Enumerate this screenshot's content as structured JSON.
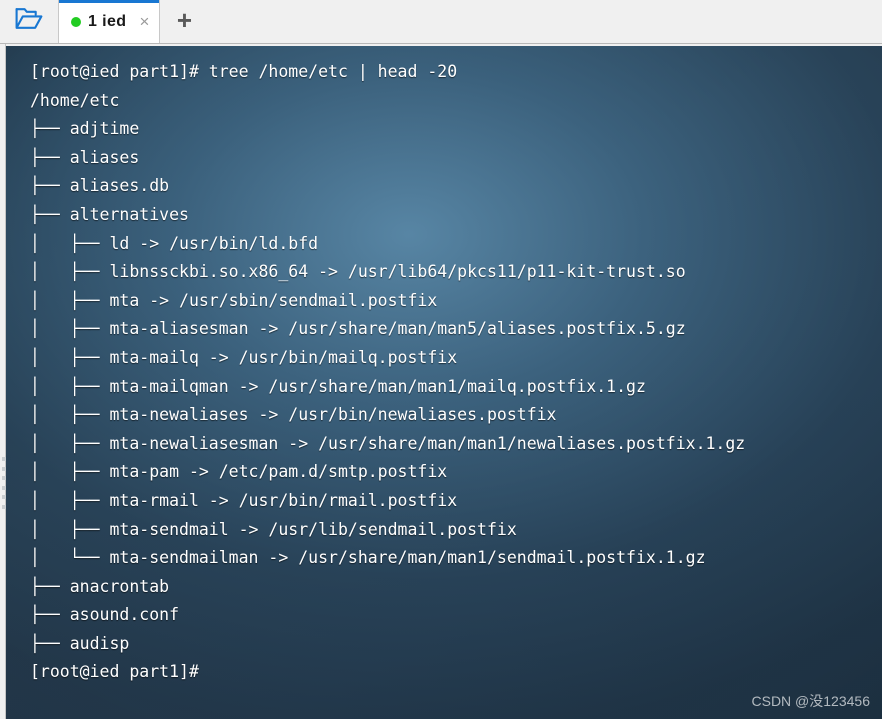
{
  "window": {
    "title": "1 ied",
    "accent_color": "#1877d2",
    "tabbar_bg": "#f0f0f0",
    "terminal_bg": "#24394b",
    "terminal_fg": "#ffffff"
  },
  "toolbar": {
    "folder_icon": "open-folder-icon",
    "new_tab_label": "+",
    "new_tab_icon": "plus-icon"
  },
  "tab": {
    "label": "1 ied",
    "status_icon": "green-dot-icon",
    "status_color": "#22cc22",
    "close_label": "×",
    "close_icon": "close-x-icon"
  },
  "terminal": {
    "prompt": "[root@ied part1]#",
    "command": "tree /home/etc | head -20",
    "lines": [
      "[root@ied part1]# tree /home/etc | head -20",
      "/home/etc",
      "├── adjtime",
      "├── aliases",
      "├── aliases.db",
      "├── alternatives",
      "│   ├── ld -> /usr/bin/ld.bfd",
      "│   ├── libnssckbi.so.x86_64 -> /usr/lib64/pkcs11/p11-kit-trust.so",
      "│   ├── mta -> /usr/sbin/sendmail.postfix",
      "│   ├── mta-aliasesman -> /usr/share/man/man5/aliases.postfix.5.gz",
      "│   ├── mta-mailq -> /usr/bin/mailq.postfix",
      "│   ├── mta-mailqman -> /usr/share/man/man1/mailq.postfix.1.gz",
      "│   ├── mta-newaliases -> /usr/bin/newaliases.postfix",
      "│   ├── mta-newaliasesman -> /usr/share/man/man1/newaliases.postfix.1.gz",
      "│   ├── mta-pam -> /etc/pam.d/smtp.postfix",
      "│   ├── mta-rmail -> /usr/bin/rmail.postfix",
      "│   ├── mta-sendmail -> /usr/lib/sendmail.postfix",
      "│   └── mta-sendmailman -> /usr/share/man/man1/sendmail.postfix.1.gz",
      "├── anacrontab",
      "├── asound.conf",
      "├── audisp",
      "[root@ied part1]#"
    ]
  },
  "watermark": {
    "text": "CSDN @没123456"
  }
}
